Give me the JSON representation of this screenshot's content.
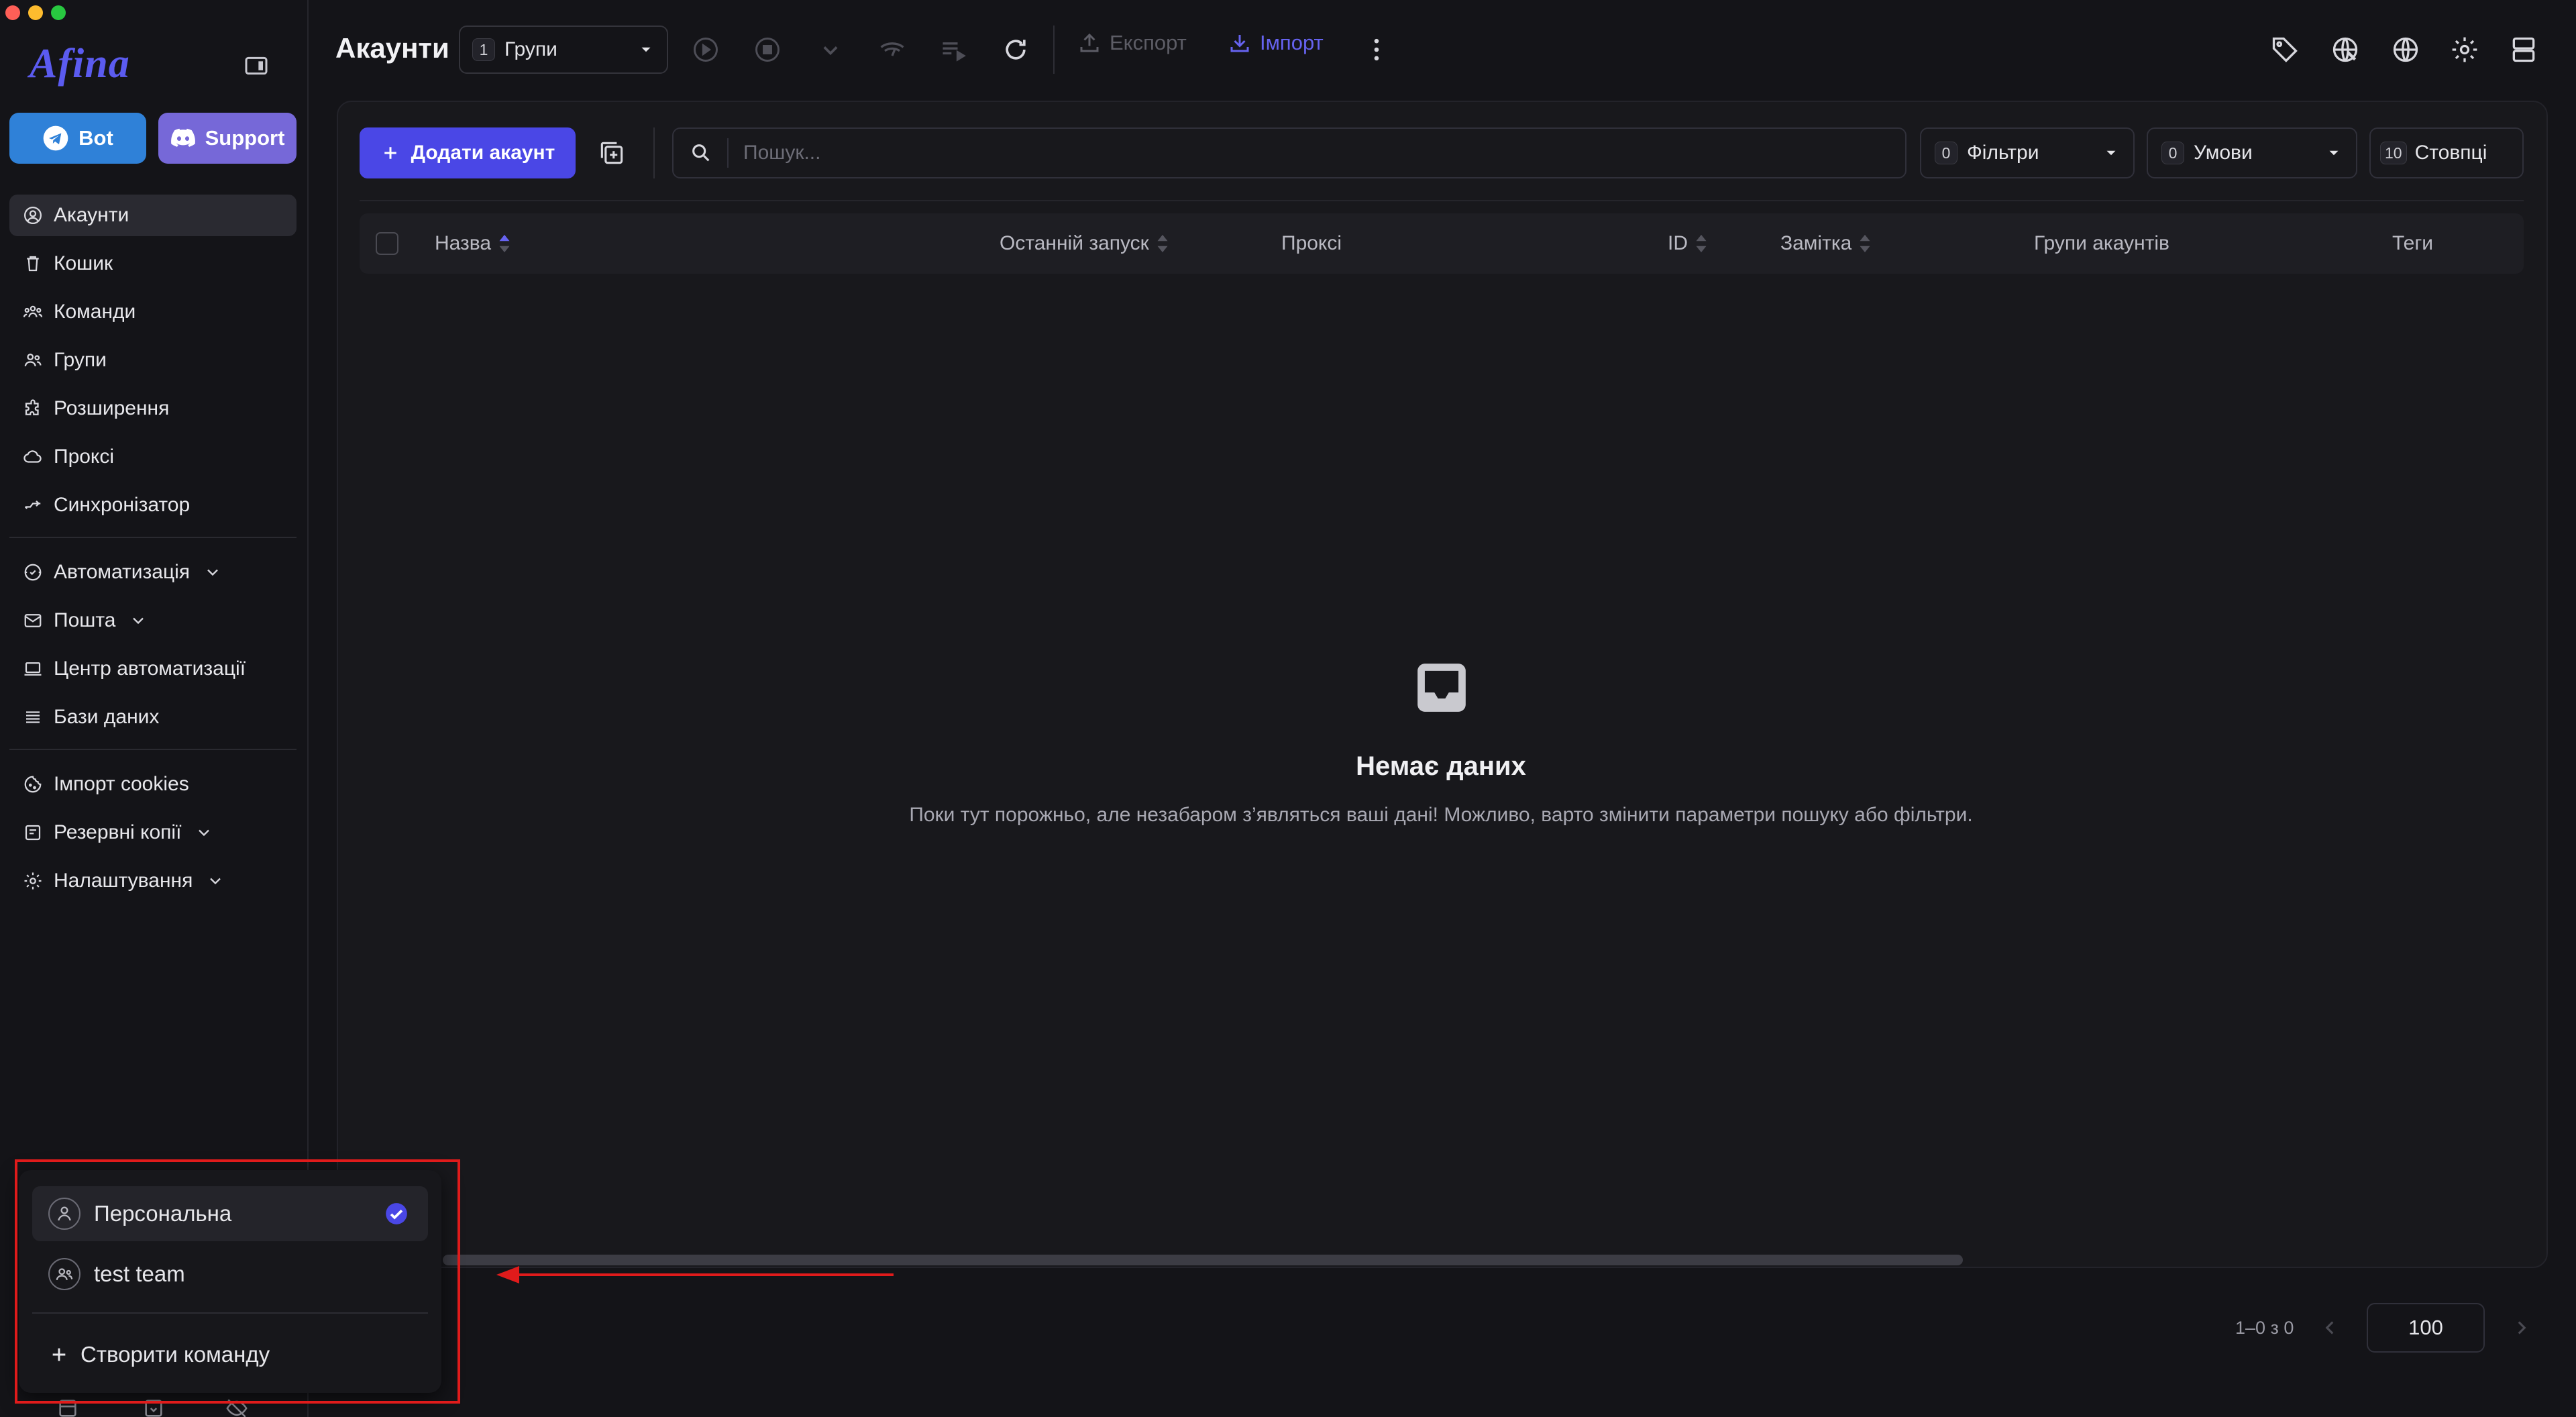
{
  "app": {
    "logo": "Afina"
  },
  "colors": {
    "accent": "#4a47e6",
    "bot": "#2f81d8",
    "support": "#7668d8",
    "highlight": "#e01b1b"
  },
  "sidebar": {
    "bot_label": "Bot",
    "support_label": "Support",
    "items": [
      {
        "label": "Акаунти",
        "icon": "user-circle-icon"
      },
      {
        "label": "Кошик",
        "icon": "trash-icon"
      },
      {
        "label": "Команди",
        "icon": "team-icon"
      },
      {
        "label": "Групи",
        "icon": "users-icon"
      },
      {
        "label": "Розширення",
        "icon": "puzzle-icon"
      },
      {
        "label": "Проксі",
        "icon": "cloud-icon"
      },
      {
        "label": "Синхронізатор",
        "icon": "sync-icon"
      },
      {
        "label": "Автоматизація",
        "icon": "automation-icon"
      },
      {
        "label": "Пошта",
        "icon": "mail-icon"
      },
      {
        "label": "Центр автоматизації",
        "icon": "laptop-icon"
      },
      {
        "label": "Бази даних",
        "icon": "list-icon"
      },
      {
        "label": "Імпорт cookies",
        "icon": "cookie-icon"
      },
      {
        "label": "Резервні копії",
        "icon": "backup-icon"
      },
      {
        "label": "Налаштування",
        "icon": "gear-icon"
      }
    ]
  },
  "header": {
    "title": "Акаунти",
    "groups_count": "1",
    "groups_label": "Групи",
    "export_label": "Експорт",
    "import_label": "Імпорт"
  },
  "toolbar": {
    "add_label": "Додати акаунт",
    "search_placeholder": "Пошук...",
    "filters_count": "0",
    "filters_label": "Фільтри",
    "conditions_count": "0",
    "conditions_label": "Умови",
    "columns_count": "10",
    "columns_label": "Стовпці"
  },
  "table": {
    "columns": [
      "Назва",
      "Останній запуск",
      "Проксі",
      "ID",
      "Замітка",
      "Групи акаунтів",
      "Теги"
    ]
  },
  "empty": {
    "title": "Немає даних",
    "subtitle": "Поки тут порожньо, але незабаром з’являться ваші дані! Можливо, варто змінити параметри пошуку або фільтри."
  },
  "pagination": {
    "range": "1–0 з 0",
    "page_size": "100"
  },
  "team_menu": {
    "items": [
      {
        "label": "Персональна",
        "selected": true
      },
      {
        "label": "test team",
        "selected": false
      }
    ],
    "create_label": "Створити команду"
  }
}
